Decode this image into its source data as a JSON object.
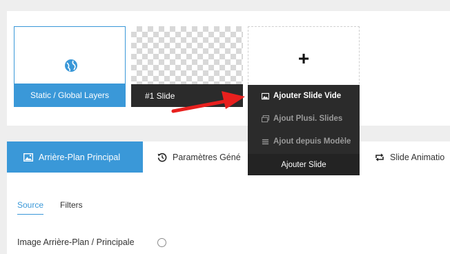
{
  "slides": {
    "static": {
      "label": "Static / Global Layers",
      "icon": "globe-icon"
    },
    "slide1": {
      "label": "#1 Slide"
    },
    "add": {
      "icon": "plus-icon"
    }
  },
  "dropdown": {
    "items": [
      {
        "label": "Ajouter Slide Vide",
        "icon": "image-icon",
        "enabled": true
      },
      {
        "label": "Ajout Plusi. Slides",
        "icon": "images-icon",
        "enabled": false
      },
      {
        "label": "Ajout depuis Modèle",
        "icon": "list-icon",
        "enabled": false
      }
    ],
    "footer": "Ajouter Slide"
  },
  "tabs": [
    {
      "label": "Arrière-Plan Principal",
      "icon": "image-icon",
      "active": true
    },
    {
      "label": "Paramètres Géné",
      "icon": "history-icon",
      "active": false
    },
    {
      "label": "Slide Animatio",
      "icon": "repeat-icon",
      "active": false
    }
  ],
  "subtabs": {
    "source": "Source",
    "filters": "Filters"
  },
  "main": {
    "bg_label": "Image Arrière-Plan / Principale"
  },
  "colors": {
    "accent": "#3a98d8",
    "dark": "#2b2b2b",
    "arrow": "#e8201e"
  }
}
